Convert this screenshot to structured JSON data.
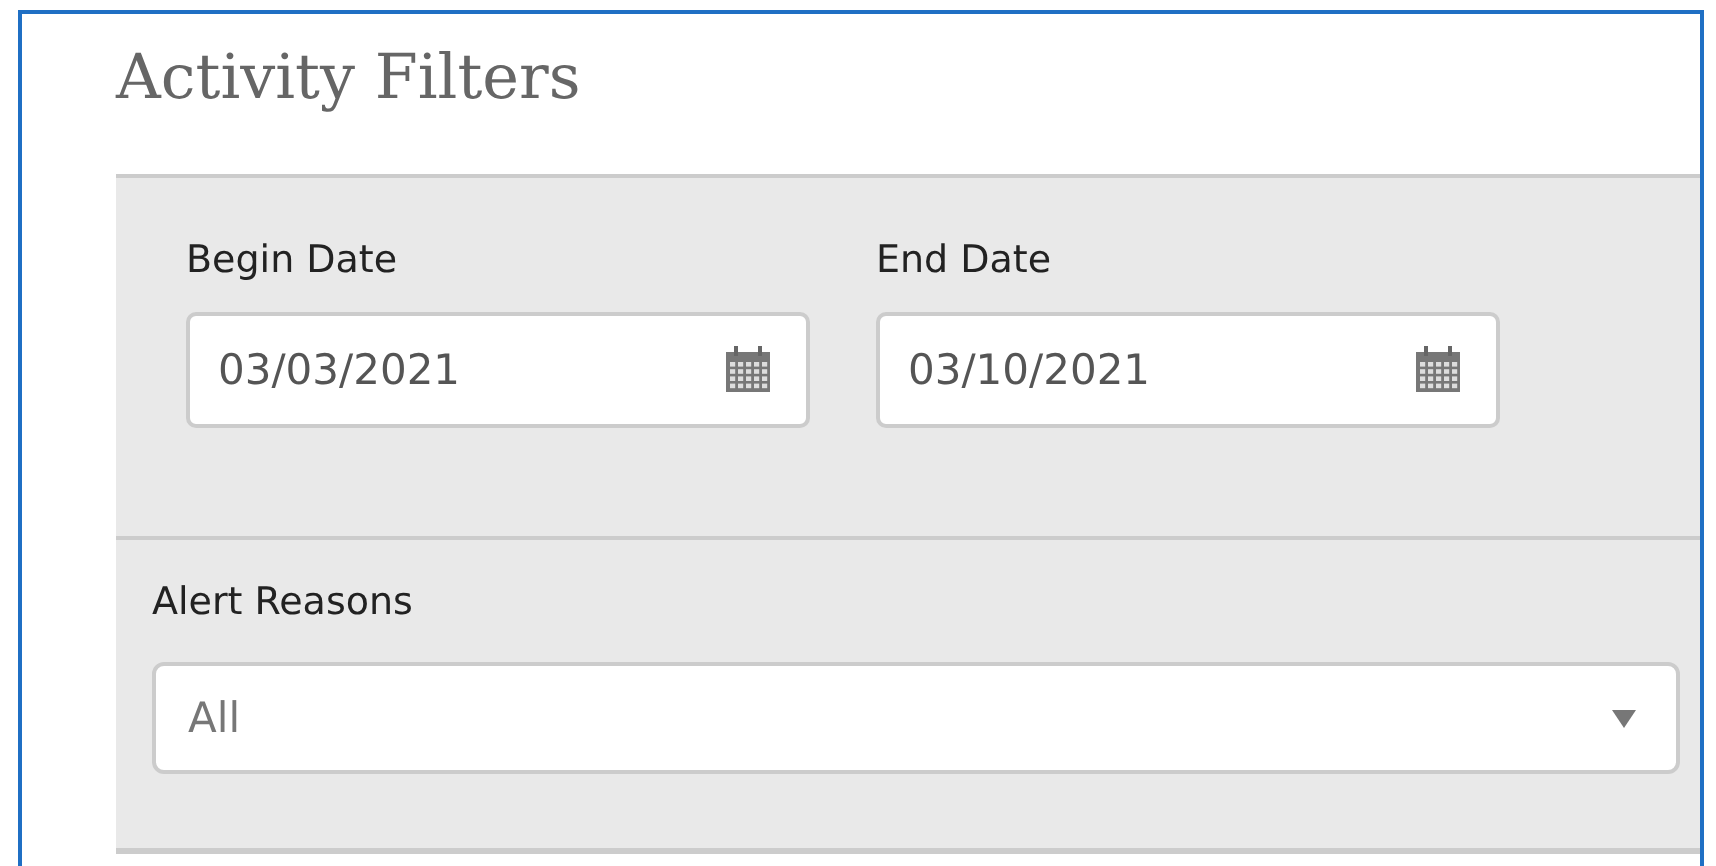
{
  "title": "Activity Filters",
  "date_fields": [
    {
      "label": "Begin Date",
      "value": "03/03/2021"
    },
    {
      "label": "End Date",
      "value": "03/10/2021"
    }
  ],
  "alert_reasons": {
    "label": "Alert Reasons",
    "value": "All"
  }
}
